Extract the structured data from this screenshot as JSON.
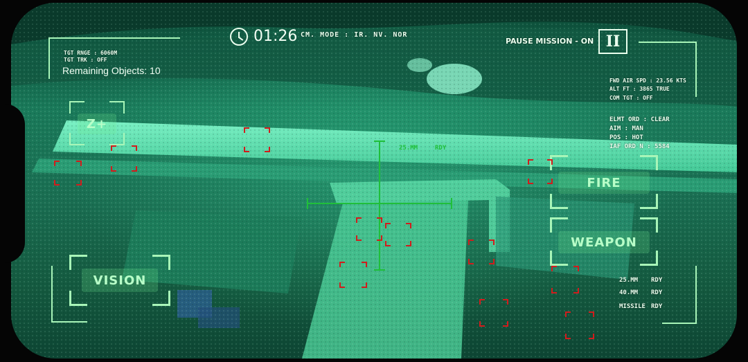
{
  "hud": {
    "timer": "01:26",
    "cam_mode": "CM. MODE : IR. NV. NOR",
    "pause_mission": "PAUSE MISSION - ON",
    "pause_icon_label": "II",
    "tgt_range": "TGT RNGE : 6060M",
    "tgt_track": "TGT TRK : OFF",
    "remaining_objects": "Remaining Objects: 10",
    "fwd_air_spd": "FWD AIR SPD : 23.56 KTS",
    "alt_ft": "ALT FT : 3865 TRUE",
    "com_tgt": "COM TGT : OFF",
    "elmt_ord": "ELMT ORD : CLEAR",
    "aim": "AIM : MAN",
    "pos": "POS : HOT",
    "iaf_ord": "IAF ORD N : 5584",
    "crosshair_weapon": "25.MM",
    "crosshair_status": "RDY"
  },
  "buttons": {
    "zoom": "Z+",
    "vision": "VISION",
    "fire": "FIRE",
    "weapon": "WEAPON"
  },
  "weapons": [
    {
      "name": "25.MM",
      "status": "RDY"
    },
    {
      "name": "40.MM",
      "status": "RDY"
    },
    {
      "name": "MISSILE",
      "status": "RDY"
    }
  ],
  "icons": {
    "clock": "clock-icon",
    "pause": "pause-icon"
  },
  "colors": {
    "hud_bracket": "#a8f5b8",
    "button_text": "#b8ffc8",
    "target_marker": "#d21c1c",
    "crosshair": "#1fbf3a",
    "night_vision_base": "#1a7a5a"
  }
}
